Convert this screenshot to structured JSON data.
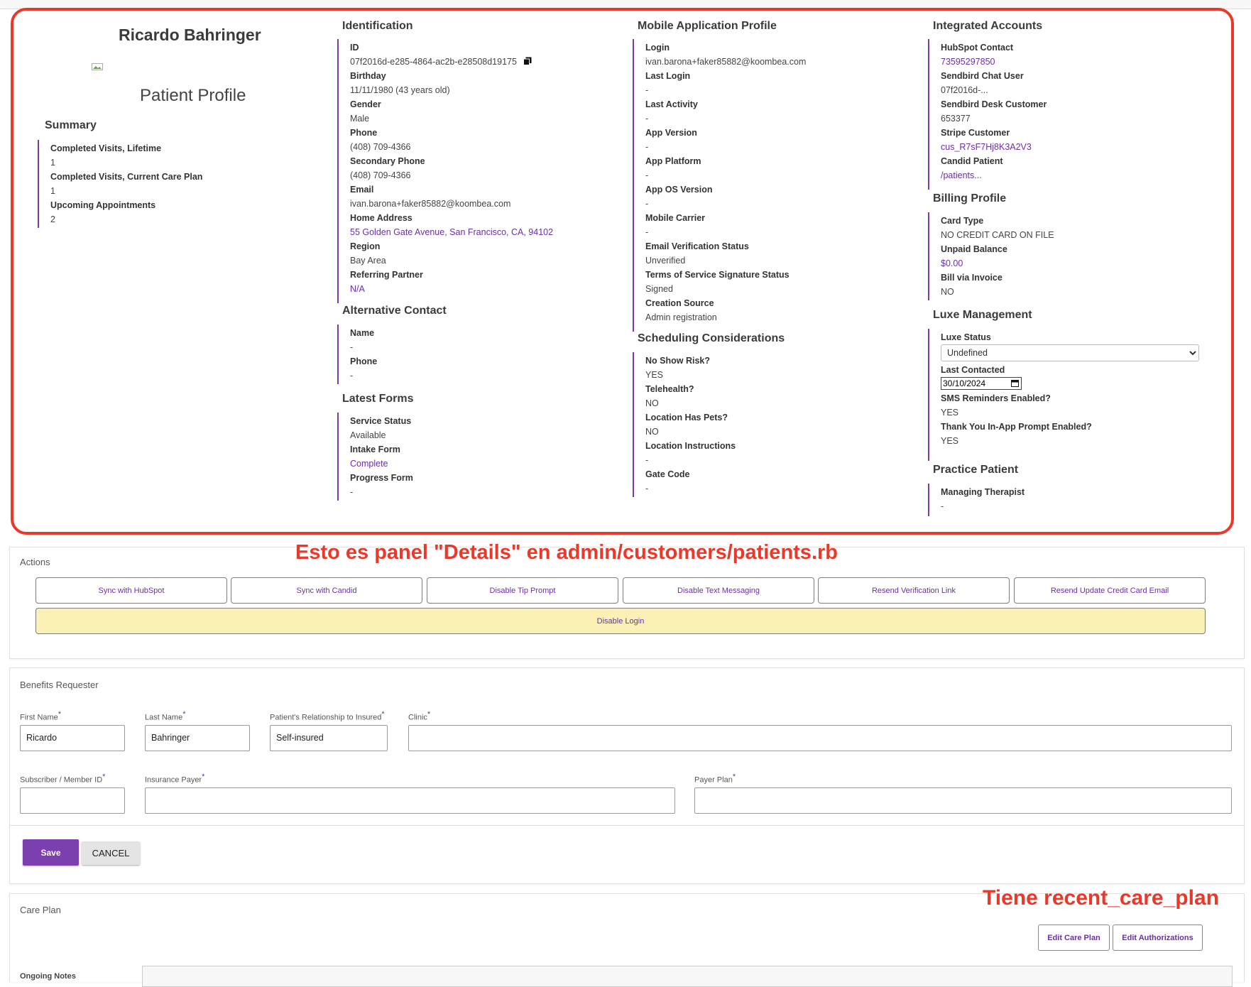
{
  "patient_name": "Ricardo Bahringer",
  "profile_title": "Patient Profile",
  "summary": {
    "title": "Summary",
    "items": [
      {
        "label": "Completed Visits, Lifetime",
        "value": "1"
      },
      {
        "label": "Completed Visits, Current Care Plan",
        "value": "1"
      },
      {
        "label": "Upcoming Appointments",
        "value": "2"
      }
    ]
  },
  "identification": {
    "title": "Identification",
    "items": [
      {
        "label": "ID",
        "value": "07f2016d-e285-4864-ac2b-e28508d19175"
      },
      {
        "label": "Birthday",
        "value": "11/11/1980 (43 years old)"
      },
      {
        "label": "Gender",
        "value": "Male"
      },
      {
        "label": "Phone",
        "value": "(408) 709-4366"
      },
      {
        "label": "Secondary Phone",
        "value": "(408) 709-4366"
      },
      {
        "label": "Email",
        "value": "ivan.barona+faker85882@koombea.com"
      },
      {
        "label": "Home Address",
        "value": "55 Golden Gate Avenue, San Francisco, CA, 94102"
      },
      {
        "label": "Region",
        "value": "Bay Area"
      },
      {
        "label": "Referring Partner",
        "value": "N/A"
      }
    ]
  },
  "alternative_contact": {
    "title": "Alternative Contact",
    "items": [
      {
        "label": "Name",
        "value": "-"
      },
      {
        "label": "Phone",
        "value": "-"
      }
    ]
  },
  "latest_forms": {
    "title": "Latest Forms",
    "items": [
      {
        "label": "Service Status",
        "value": "Available"
      },
      {
        "label": "Intake Form",
        "value": "Complete"
      },
      {
        "label": "Progress Form",
        "value": "-"
      }
    ]
  },
  "mobile_profile": {
    "title": "Mobile Application Profile",
    "items": [
      {
        "label": "Login",
        "value": "ivan.barona+faker85882@koombea.com"
      },
      {
        "label": "Last Login",
        "value": "-"
      },
      {
        "label": "Last Activity",
        "value": "-"
      },
      {
        "label": "App Version",
        "value": "-"
      },
      {
        "label": "App Platform",
        "value": "-"
      },
      {
        "label": "App OS Version",
        "value": "-"
      },
      {
        "label": "Mobile Carrier",
        "value": "-"
      },
      {
        "label": "Email Verification Status",
        "value": "Unverified"
      },
      {
        "label": "Terms of Service Signature Status",
        "value": "Signed"
      },
      {
        "label": "Creation Source",
        "value": "Admin registration"
      }
    ]
  },
  "scheduling": {
    "title": "Scheduling Considerations",
    "items": [
      {
        "label": "No Show Risk?",
        "value": "YES"
      },
      {
        "label": "Telehealth?",
        "value": "NO"
      },
      {
        "label": "Location Has Pets?",
        "value": "NO"
      },
      {
        "label": "Location Instructions",
        "value": "-"
      },
      {
        "label": "Gate Code",
        "value": "-"
      }
    ]
  },
  "integrated_accounts": {
    "title": "Integrated Accounts",
    "items": [
      {
        "label": "HubSpot Contact",
        "value": "73595297850"
      },
      {
        "label": "Sendbird Chat User",
        "value": "07f2016d-..."
      },
      {
        "label": "Sendbird Desk Customer",
        "value": "653377"
      },
      {
        "label": "Stripe Customer",
        "value": "cus_R7sF7Hj8K3A2V3"
      },
      {
        "label": "Candid Patient",
        "value": "/patients..."
      }
    ]
  },
  "billing": {
    "title": "Billing Profile",
    "items": [
      {
        "label": "Card Type",
        "value": "NO CREDIT CARD ON FILE"
      },
      {
        "label": "Unpaid Balance",
        "value": "$0.00"
      },
      {
        "label": "Bill via Invoice",
        "value": "NO"
      }
    ]
  },
  "luxe": {
    "title": "Luxe Management",
    "status_label": "Luxe Status",
    "status_value": "Undefined",
    "last_contacted_label": "Last Contacted",
    "last_contacted_value": "30/10/2024",
    "items": [
      {
        "label": "SMS Reminders Enabled?",
        "value": "YES"
      },
      {
        "label": "Thank You In-App Prompt Enabled?",
        "value": "YES"
      }
    ]
  },
  "practice": {
    "title": "Practice Patient",
    "items": [
      {
        "label": "Managing Therapist",
        "value": "-"
      }
    ]
  },
  "annotations": {
    "details_panel": "Esto es panel \"Details\" en admin/customers/patients.rb",
    "care_plan": "Tiene recent_care_plan"
  },
  "actions": {
    "title": "Actions",
    "buttons": [
      "Sync with HubSpot",
      "Sync with Candid",
      "Disable Tip Prompt",
      "Disable Text Messaging",
      "Resend Verification Link",
      "Resend Update Credit Card Email"
    ],
    "disable_login": "Disable Login"
  },
  "benefits": {
    "title": "Benefits Requester",
    "first_name_label": "First Name",
    "first_name_value": "Ricardo",
    "last_name_label": "Last Name",
    "last_name_value": "Bahringer",
    "relationship_label": "Patient's Relationship to Insured",
    "relationship_value": "Self-insured",
    "clinic_label": "Clinic",
    "clinic_value": "",
    "subscriber_label": "Subscriber / Member ID",
    "subscriber_value": "",
    "payer_label": "Insurance Payer",
    "payer_value": "",
    "plan_label": "Payer Plan",
    "plan_value": "",
    "required_mark": "*",
    "save": "Save",
    "cancel": "CANCEL"
  },
  "care_plan": {
    "title": "Care Plan",
    "edit_care_plan": "Edit Care Plan",
    "edit_authorizations": "Edit Authorizations",
    "ongoing_notes_label": "Ongoing Notes"
  },
  "colors": {
    "accent": "#7b3fb0",
    "link": "#6b2fa8",
    "annotation": "#e8392b",
    "warning_button": "#fbf1b6"
  }
}
